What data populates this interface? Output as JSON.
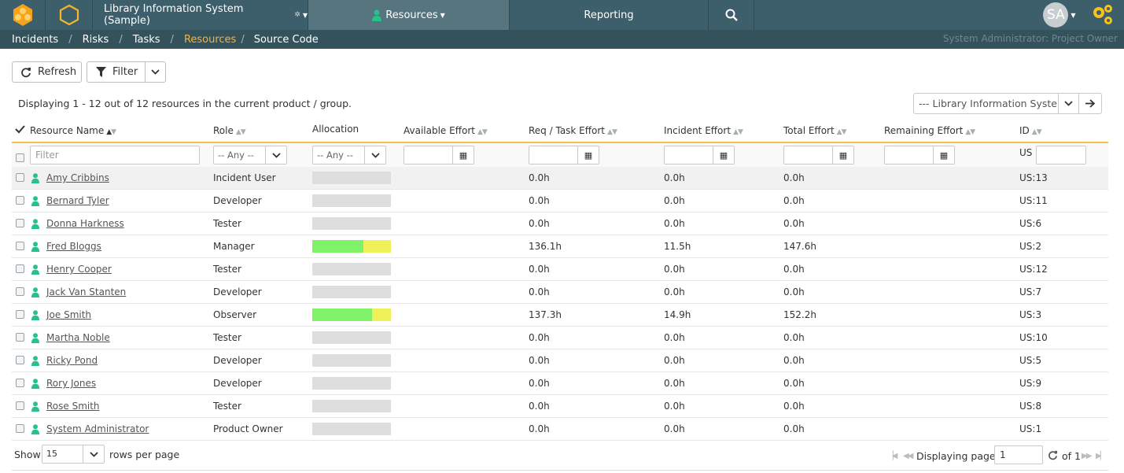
{
  "topbar": {
    "project_name": "Library Information System (Sample)",
    "resources_label": "Resources",
    "reporting_label": "Reporting",
    "avatar_initials": "SA"
  },
  "subnav": {
    "items": [
      "Incidents",
      "Risks",
      "Tasks",
      "Resources",
      "Source Code"
    ],
    "active": "Resources",
    "user_role": "System Administrator: Project Owner"
  },
  "toolbar": {
    "refresh_label": "Refresh",
    "filter_label": "Filter"
  },
  "status_text": "Displaying 1 - 12 out of 12 resources in the current product / group.",
  "project_selector": {
    "value": "--- Library Information System ---"
  },
  "columns": {
    "name": "Resource Name",
    "role": "Role",
    "allocation": "Allocation",
    "available": "Available Effort",
    "req_task": "Req / Task Effort",
    "incident": "Incident Effort",
    "total": "Total Effort",
    "remaining": "Remaining Effort",
    "id": "ID"
  },
  "filters": {
    "name_placeholder": "Filter",
    "role_value": "-- Any --",
    "allocation_value": "-- Any --",
    "id_prefix": "US"
  },
  "rows": [
    {
      "name": "Amy Cribbins",
      "role": "Incident User",
      "alloc_green": 0,
      "alloc_yellow": 0,
      "req_task": "0.0h",
      "incident": "0.0h",
      "total": "0.0h",
      "id": "US:13"
    },
    {
      "name": "Bernard Tyler",
      "role": "Developer",
      "alloc_green": 0,
      "alloc_yellow": 0,
      "req_task": "0.0h",
      "incident": "0.0h",
      "total": "0.0h",
      "id": "US:11"
    },
    {
      "name": "Donna Harkness",
      "role": "Tester",
      "alloc_green": 0,
      "alloc_yellow": 0,
      "req_task": "0.0h",
      "incident": "0.0h",
      "total": "0.0h",
      "id": "US:6"
    },
    {
      "name": "Fred Bloggs",
      "role": "Manager",
      "alloc_green": 0.65,
      "alloc_yellow": 0.35,
      "req_task": "136.1h",
      "incident": "11.5h",
      "total": "147.6h",
      "id": "US:2"
    },
    {
      "name": "Henry Cooper",
      "role": "Tester",
      "alloc_green": 0,
      "alloc_yellow": 0,
      "req_task": "0.0h",
      "incident": "0.0h",
      "total": "0.0h",
      "id": "US:12"
    },
    {
      "name": "Jack Van Stanten",
      "role": "Developer",
      "alloc_green": 0,
      "alloc_yellow": 0,
      "req_task": "0.0h",
      "incident": "0.0h",
      "total": "0.0h",
      "id": "US:7"
    },
    {
      "name": "Joe Smith",
      "role": "Observer",
      "alloc_green": 0.76,
      "alloc_yellow": 0.24,
      "req_task": "137.3h",
      "incident": "14.9h",
      "total": "152.2h",
      "id": "US:3"
    },
    {
      "name": "Martha Noble",
      "role": "Tester",
      "alloc_green": 0,
      "alloc_yellow": 0,
      "req_task": "0.0h",
      "incident": "0.0h",
      "total": "0.0h",
      "id": "US:10"
    },
    {
      "name": "Ricky Pond",
      "role": "Developer",
      "alloc_green": 0,
      "alloc_yellow": 0,
      "req_task": "0.0h",
      "incident": "0.0h",
      "total": "0.0h",
      "id": "US:5"
    },
    {
      "name": "Rory Jones",
      "role": "Developer",
      "alloc_green": 0,
      "alloc_yellow": 0,
      "req_task": "0.0h",
      "incident": "0.0h",
      "total": "0.0h",
      "id": "US:9"
    },
    {
      "name": "Rose Smith",
      "role": "Tester",
      "alloc_green": 0,
      "alloc_yellow": 0,
      "req_task": "0.0h",
      "incident": "0.0h",
      "total": "0.0h",
      "id": "US:8"
    },
    {
      "name": "System Administrator",
      "role": "Product Owner",
      "alloc_green": 0,
      "alloc_yellow": 0,
      "req_task": "0.0h",
      "incident": "0.0h",
      "total": "0.0h",
      "id": "US:1"
    }
  ],
  "footer": {
    "show_label": "Show",
    "rows_per_page": "15",
    "rows_per_page_label": "rows per page",
    "displaying_page_label": "Displaying page",
    "page_value": "1",
    "of_label": "of 1"
  },
  "colors": {
    "topbar": "#3d5e6b",
    "active_crumb": "#f6b23b",
    "alloc_green": "#7ff26a",
    "alloc_yellow": "#f0f05a",
    "accent_line": "#f4c24a"
  }
}
